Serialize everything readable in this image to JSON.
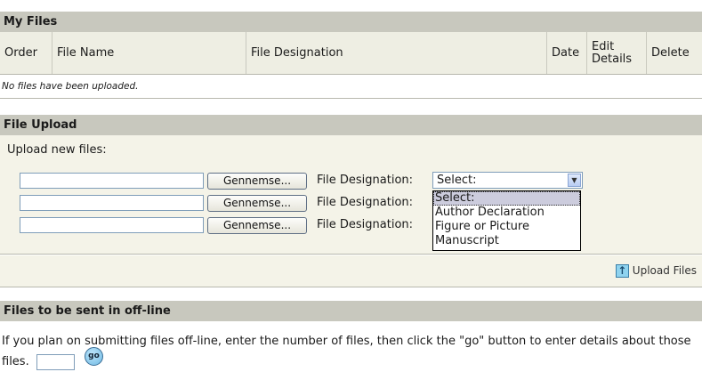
{
  "my_files": {
    "title": "My Files",
    "columns": [
      "Order",
      "File Name",
      "File Designation",
      "Date",
      "Edit Details",
      "Delete"
    ],
    "empty_message": "No files have been uploaded."
  },
  "file_upload": {
    "title": "File Upload",
    "upload_label": "Upload new files:",
    "rows": [
      {
        "browse_label": "Gennemse...",
        "designation_label": "File Designation:"
      },
      {
        "browse_label": "Gennemse...",
        "designation_label": "File Designation:"
      },
      {
        "browse_label": "Gennemse...",
        "designation_label": "File Designation:"
      }
    ],
    "select_value": "Select:",
    "select_options": [
      "Select:",
      "Author Declaration",
      "Figure or Picture",
      "Manuscript"
    ],
    "upload_button_label": "Upload Files",
    "upload_icon": "arrow-up-icon"
  },
  "offline": {
    "title": "Files to be sent in off-line",
    "instructions": "If you plan on submitting files off-line, enter the number of files, then click the \"go\" button to enter details about those files.",
    "go_label": "go"
  }
}
